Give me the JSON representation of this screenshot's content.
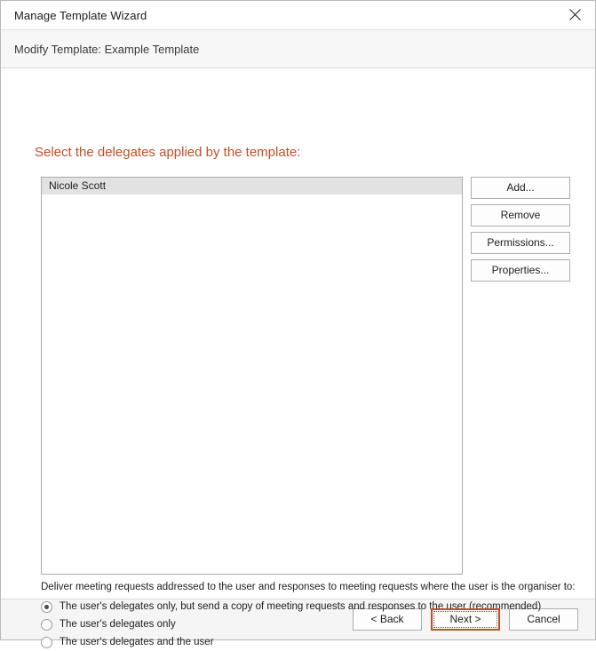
{
  "window": {
    "title": "Manage Template Wizard",
    "close_icon": "close-icon",
    "subtitle": "Modify Template: Example Template"
  },
  "page": {
    "heading": "Select the delegates applied by the template:",
    "heading_color": "#c05027"
  },
  "delegates_list": {
    "items": [
      {
        "name": "Nicole Scott",
        "selected": true
      }
    ]
  },
  "side_buttons": [
    {
      "label": "Add..."
    },
    {
      "label": "Remove"
    },
    {
      "label": "Permissions..."
    },
    {
      "label": "Properties..."
    }
  ],
  "options": {
    "description": "Deliver meeting requests addressed to the user and responses to meeting requests where the user is the organiser to:",
    "radios": [
      {
        "label": "The user's delegates only, but send a copy of meeting requests and responses to the user (recommended)",
        "checked": true
      },
      {
        "label": "The user's delegates only",
        "checked": false
      },
      {
        "label": "The user's delegates and the user",
        "checked": false
      }
    ]
  },
  "footer": {
    "back_label": "< Back",
    "next_label": "Next >",
    "cancel_label": "Cancel",
    "default_button": "Next >",
    "default_border_color": "#c05027"
  }
}
